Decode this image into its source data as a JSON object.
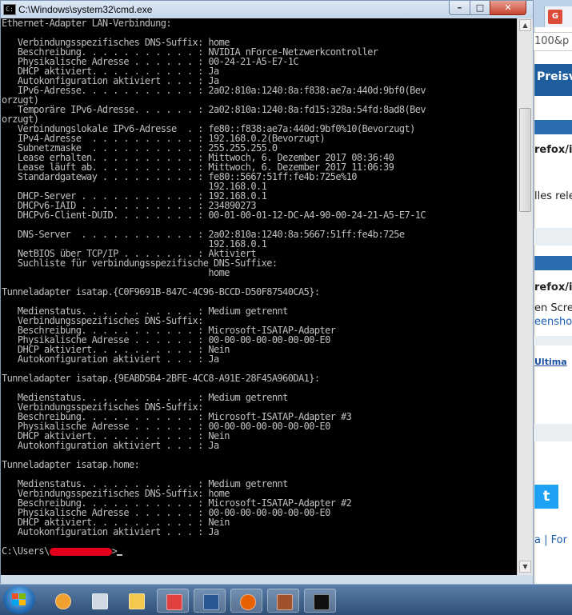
{
  "window": {
    "title": "C:\\Windows\\system32\\cmd.exe",
    "min_label": "–",
    "max_label": "□",
    "close_label": "✕"
  },
  "console": {
    "lines": [
      "Ethernet-Adapter LAN-Verbindung:",
      "",
      "   Verbindungsspezifisches DNS-Suffix: home",
      "   Beschreibung. . . . . . . . . . . : NVIDIA nForce-Netzwerkcontroller",
      "   Physikalische Adresse . . . . . . : 00-24-21-A5-E7-1C",
      "   DHCP aktiviert. . . . . . . . . . : Ja",
      "   Autokonfiguration aktiviert . . . : Ja",
      "   IPv6-Adresse. . . . . . . . . . . : 2a02:810a:1240:8a:f838:ae7a:440d:9bf0(Bev",
      "orzugt)",
      "   Temporäre IPv6-Adresse. . . . . . : 2a02:810a:1240:8a:fd15:328a:54fd:8ad8(Bev",
      "orzugt)",
      "   Verbindungslokale IPv6-Adresse  . : fe80::f838:ae7a:440d:9bf0%10(Bevorzugt)",
      "   IPv4-Adresse  . . . . . . . . . . : 192.168.0.2(Bevorzugt)",
      "   Subnetzmaske  . . . . . . . . . . : 255.255.255.0",
      "   Lease erhalten. . . . . . . . . . : Mittwoch, 6. Dezember 2017 08:36:40",
      "   Lease läuft ab. . . . . . . . . . : Mittwoch, 6. Dezember 2017 11:06:39",
      "   Standardgateway . . . . . . . . . : fe80::5667:51ff:fe4b:725e%10",
      "                                       192.168.0.1",
      "   DHCP-Server . . . . . . . . . . . : 192.168.0.1",
      "   DHCPv6-IAID . . . . . . . . . . . : 234890273",
      "   DHCPv6-Client-DUID. . . . . . . . : 00-01-00-01-12-DC-A4-90-00-24-21-A5-E7-1C",
      "",
      "   DNS-Server  . . . . . . . . . . . : 2a02:810a:1240:8a:5667:51ff:fe4b:725e",
      "                                       192.168.0.1",
      "   NetBIOS über TCP/IP . . . . . . . : Aktiviert",
      "   Suchliste für verbindungsspezifische DNS-Suffixe:",
      "                                       home",
      "",
      "Tunneladapter isatap.{C0F9691B-847C-4C96-BCCD-D50F87540CA5}:",
      "",
      "   Medienstatus. . . . . . . . . . . : Medium getrennt",
      "   Verbindungsspezifisches DNS-Suffix:",
      "   Beschreibung. . . . . . . . . . . : Microsoft-ISATAP-Adapter",
      "   Physikalische Adresse . . . . . . : 00-00-00-00-00-00-00-E0",
      "   DHCP aktiviert. . . . . . . . . . : Nein",
      "   Autokonfiguration aktiviert . . . : Ja",
      "",
      "Tunneladapter isatap.{9EABD5B4-2BFE-4CC8-A91E-28F45A960DA1}:",
      "",
      "   Medienstatus. . . . . . . . . . . : Medium getrennt",
      "   Verbindungsspezifisches DNS-Suffix:",
      "   Beschreibung. . . . . . . . . . . : Microsoft-ISATAP-Adapter #3",
      "   Physikalische Adresse . . . . . . : 00-00-00-00-00-00-00-E0",
      "   DHCP aktiviert. . . . . . . . . . : Nein",
      "   Autokonfiguration aktiviert . . . : Ja",
      "",
      "Tunneladapter isatap.home:",
      "",
      "   Medienstatus. . . . . . . . . . . : Medium getrennt",
      "   Verbindungsspezifisches DNS-Suffix: home",
      "   Beschreibung. . . . . . . . . . . : Microsoft-ISATAP-Adapter #2",
      "   Physikalische Adresse . . . . . . : 00-00-00-00-00-00-00-E0",
      "   DHCP aktiviert. . . . . . . . . . : Nein",
      "   Autokonfiguration aktiviert . . . : Ja",
      ""
    ],
    "prompt_prefix": "C:\\Users\\",
    "prompt_suffix": ">"
  },
  "background_browser": {
    "tab_label": "G",
    "url_fragment": "100&p",
    "header_text": "Preisv",
    "texts": [
      "refox/i",
      "lles rele",
      "refox/i",
      "en Scree",
      "eensho",
      "Ultima",
      "a | For"
    ]
  },
  "taskbar": {
    "items": [
      {
        "name": "media-player-icon",
        "color": "#f0a030"
      },
      {
        "name": "calculator-icon",
        "color": "#cfd8e3"
      },
      {
        "name": "explorer-folder-icon",
        "color": "#f2c94c"
      },
      {
        "name": "snipping-tool-icon",
        "color": "#e04040"
      },
      {
        "name": "word-icon",
        "color": "#2b5797"
      },
      {
        "name": "firefox-icon",
        "color": "#e66000"
      },
      {
        "name": "archive-icon",
        "color": "#a0522d"
      },
      {
        "name": "cmd-icon",
        "color": "#111111"
      }
    ]
  },
  "colors": {
    "console_bg": "#000000",
    "console_fg": "#c0c0c0",
    "redaction": "#e2001a"
  }
}
